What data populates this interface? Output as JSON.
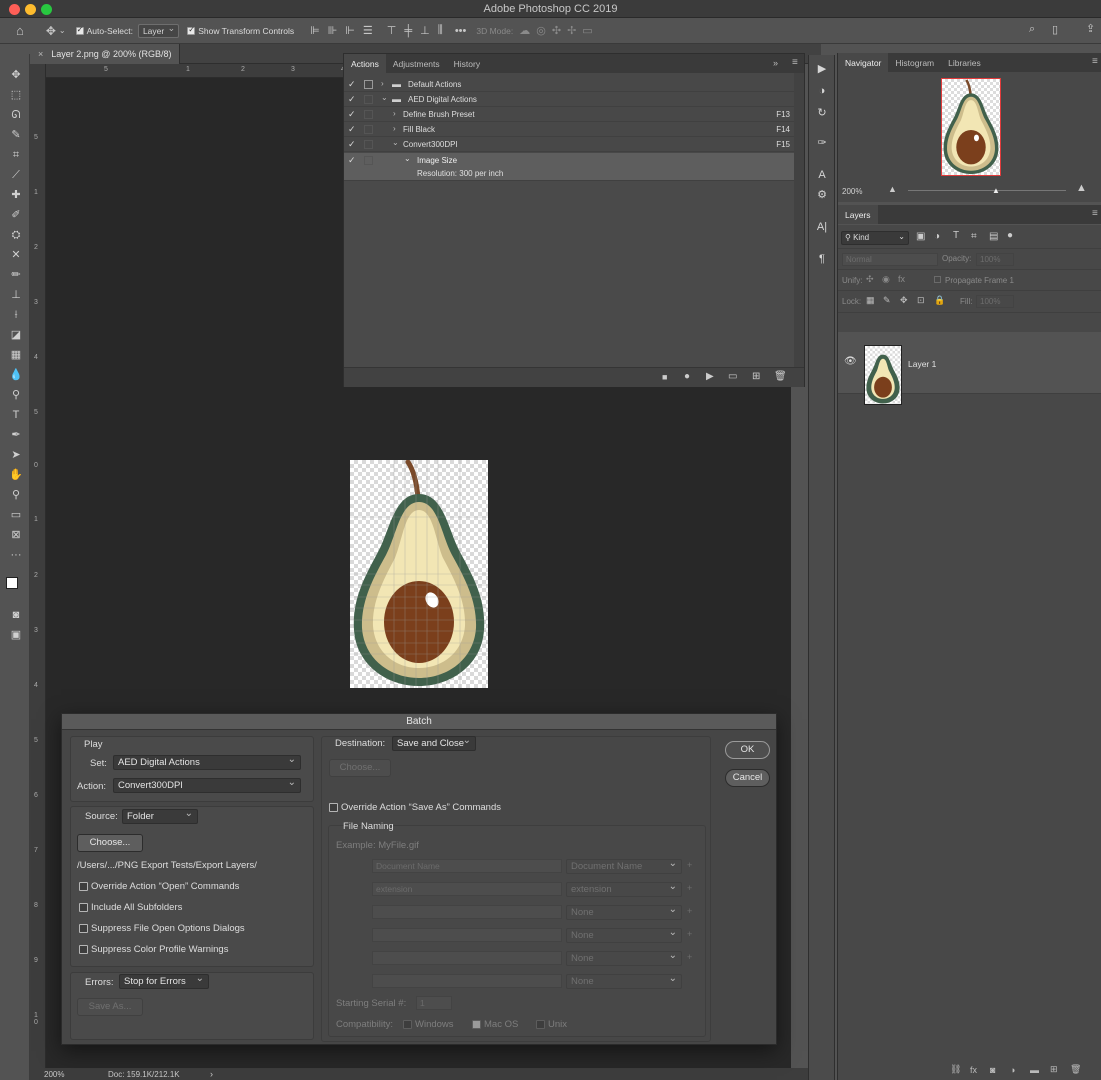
{
  "app": {
    "title": "Adobe Photoshop CC 2019"
  },
  "options_bar": {
    "auto_select_label": "Auto-Select:",
    "auto_select_value": "Layer",
    "show_transform_label": "Show Transform Controls",
    "mode_3d_label": "3D Mode:"
  },
  "document": {
    "tab_label": "Layer 2.png @ 200% (RGB/8)",
    "zoom": "200%",
    "doc_info": "Doc: 159.1K/212.1K",
    "ruler_h": [
      "5",
      "1",
      "2",
      "3",
      "4"
    ],
    "ruler_v": [
      "5",
      "1",
      "2",
      "3",
      "4",
      "5",
      "0",
      "1",
      "2",
      "3",
      "4",
      "5",
      "6",
      "7",
      "8",
      "9",
      "1 0"
    ]
  },
  "actions_panel": {
    "tabs": [
      "Actions",
      "Adjustments",
      "History"
    ],
    "rows": [
      {
        "label": "Default Actions",
        "key": ""
      },
      {
        "label": "AED Digital Actions",
        "key": ""
      },
      {
        "label": "Define Brush Preset",
        "key": "F13"
      },
      {
        "label": "Fill Black",
        "key": "F14"
      },
      {
        "label": "Convert300DPI",
        "key": "F15"
      },
      {
        "label": "Image Size",
        "key": ""
      }
    ],
    "detail": "Resolution: 300 per inch"
  },
  "navigator": {
    "tabs": [
      "Navigator",
      "Histogram",
      "Libraries"
    ],
    "zoom": "200%"
  },
  "layers_panel": {
    "tab": "Layers",
    "kind": "Kind",
    "blend_mode": "Normal",
    "opacity_label": "Opacity:",
    "opacity_value": "100%",
    "unify_label": "Unify:",
    "propagate_label": "Propagate Frame 1",
    "lock_label": "Lock:",
    "fill_label": "Fill:",
    "fill_value": "100%",
    "layer_name": "Layer 1"
  },
  "batch": {
    "title": "Batch",
    "play_label": "Play",
    "set_label": "Set:",
    "set_value": "AED Digital Actions",
    "action_label": "Action:",
    "action_value": "Convert300DPI",
    "source_label": "Source:",
    "source_value": "Folder",
    "choose_label": "Choose...",
    "source_path": "/Users/.../PNG Export Tests/Export Layers/",
    "override_open": "Override Action “Open” Commands",
    "include_subfolders": "Include All Subfolders",
    "suppress_open": "Suppress File Open Options Dialogs",
    "suppress_color": "Suppress Color Profile Warnings",
    "errors_label": "Errors:",
    "errors_value": "Stop for Errors",
    "save_as_label": "Save As...",
    "destination_label": "Destination:",
    "destination_value": "Save and Close",
    "dest_choose_label": "Choose...",
    "override_save": "Override Action “Save As” Commands",
    "file_naming_label": "File Naming",
    "example_label": "Example: MyFile.gif",
    "naming_rows": [
      {
        "field": "Document Name",
        "select": "Document Name"
      },
      {
        "field": "extension",
        "select": "extension"
      },
      {
        "field": "",
        "select": "None"
      },
      {
        "field": "",
        "select": "None"
      },
      {
        "field": "",
        "select": "None"
      },
      {
        "field": "",
        "select": "None"
      }
    ],
    "serial_label": "Starting Serial #:",
    "serial_value": "1",
    "compat_label": "Compatibility:",
    "windows_label": "Windows",
    "macos_label": "Mac OS",
    "unix_label": "Unix",
    "ok_label": "OK",
    "cancel_label": "Cancel"
  }
}
